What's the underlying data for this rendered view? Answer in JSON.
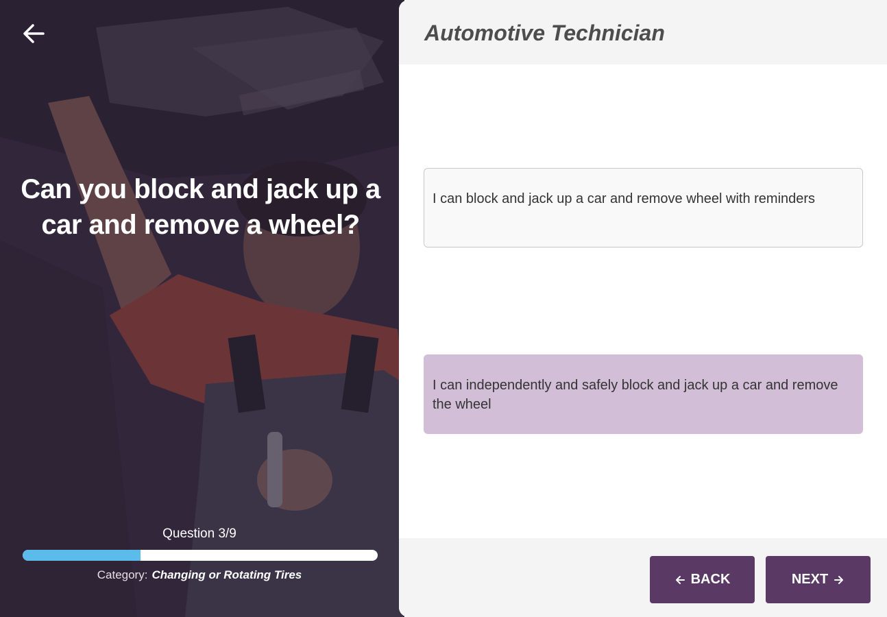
{
  "left_panel": {
    "question": "Can you block and jack up a car and remove a wheel?",
    "progress": {
      "label": "Question 3/9",
      "current": 3,
      "total": 9,
      "fraction": 0.333
    },
    "category_label": "Category:",
    "category_value": "Changing or Rotating Tires"
  },
  "right_panel": {
    "title": "Automotive Technician",
    "options": [
      {
        "text": "I can block and jack up a car and remove wheel with reminders",
        "selected": false
      },
      {
        "text": "I can independently and safely block and jack up a car and remove the wheel",
        "selected": true
      }
    ],
    "buttons": {
      "back": "BACK",
      "next": "NEXT"
    }
  },
  "colors": {
    "accent": "#5a3a65",
    "selected_option": "#d3bed8",
    "progress_fill": "#5bbcec"
  },
  "icons": [
    "arrow-left-icon",
    "arrow-left-small-icon",
    "arrow-right-small-icon"
  ]
}
